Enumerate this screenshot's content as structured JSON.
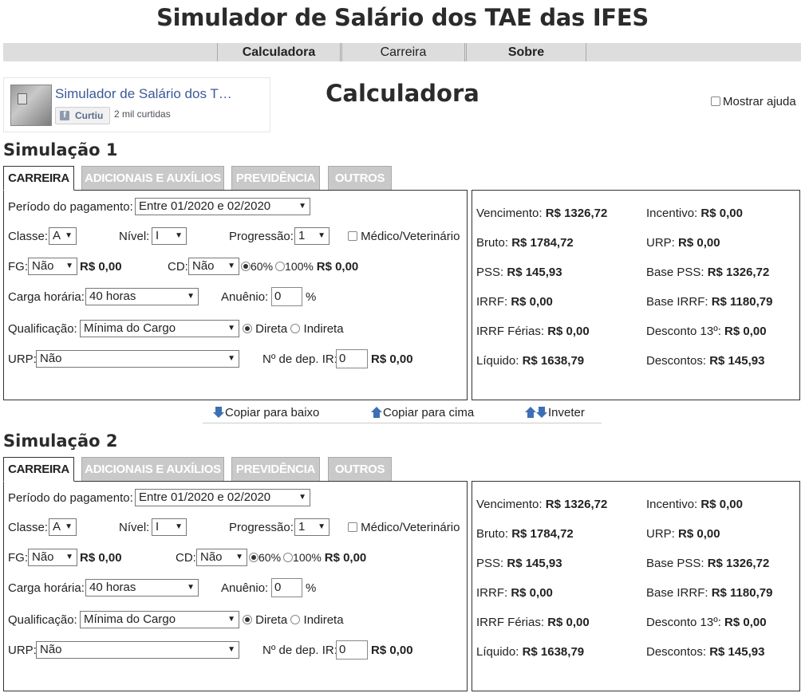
{
  "site_title": "Simulador de Salário dos TAE das IFES",
  "nav": [
    "Calculadora",
    "Carreira",
    "Sobre"
  ],
  "fb": {
    "page_name": "Simulador de Salário dos T…",
    "like_label": "Curtiu",
    "likes": "2 mil curtidas"
  },
  "page_title": "Calculadora",
  "help_label": "Mostrar ajuda",
  "copy": {
    "down": "Copiar para baixo",
    "up": "Copiar para cima",
    "swap": "Inveter"
  },
  "simulations": [
    {
      "title": "Simulação 1",
      "tabs": [
        "CARREIRA",
        "ADICIONAIS E AUXÍLIOS",
        "PREVIDÊNCIA",
        "OUTROS"
      ],
      "form": {
        "periodo_label": "Período do pagamento:",
        "periodo": "Entre 01/2020 e 02/2020",
        "classe_label": "Classe:",
        "classe": "A",
        "nivel_label": "Nível:",
        "nivel": "I",
        "progressao_label": "Progressão:",
        "progressao": "1",
        "medico_label": "Médico/Veterinário",
        "fg_label": "FG:",
        "fg": "Não",
        "fg_value": "R$ 0,00",
        "cd_label": "CD:",
        "cd": "Não",
        "cd_60": "60%",
        "cd_100": "100%",
        "cd_value": "R$ 0,00",
        "carga_label": "Carga horária:",
        "carga": "40 horas",
        "anuenio_label": "Anuênio:",
        "anuenio": "0",
        "anuenio_unit": "%",
        "qualificacao_label": "Qualificação:",
        "qualificacao": "Mínima do Cargo",
        "direta": "Direta",
        "indireta": "Indireta",
        "urp_label": "URP:",
        "urp": "Não",
        "dep_label": "Nº de dep. IR:",
        "dep": "0",
        "dep_value": "R$ 0,00"
      },
      "results": {
        "vencimento_label": "Vencimento:",
        "vencimento": "R$ 1326,72",
        "incentivo_label": "Incentivo:",
        "incentivo": "R$ 0,00",
        "bruto_label": "Bruto:",
        "bruto": "R$ 1784,72",
        "urp_label": "URP:",
        "urp": "R$ 0,00",
        "pss_label": "PSS:",
        "pss": "R$ 145,93",
        "base_pss_label": "Base PSS:",
        "base_pss": "R$ 1326,72",
        "irrf_label": "IRRF:",
        "irrf": "R$ 0,00",
        "base_irrf_label": "Base IRRF:",
        "base_irrf": "R$ 1180,79",
        "irrf_ferias_label": "IRRF Férias:",
        "irrf_ferias": "R$ 0,00",
        "desconto13_label": "Desconto 13º:",
        "desconto13": "R$ 0,00",
        "liquido_label": "Líquido:",
        "liquido": "R$ 1638,79",
        "descontos_label": "Descontos:",
        "descontos": "R$ 145,93"
      }
    },
    {
      "title": "Simulação 2",
      "tabs": [
        "CARREIRA",
        "ADICIONAIS E AUXÍLIOS",
        "PREVIDÊNCIA",
        "OUTROS"
      ],
      "form": {
        "periodo_label": "Período do pagamento:",
        "periodo": "Entre 01/2020 e 02/2020",
        "classe_label": "Classe:",
        "classe": "A",
        "nivel_label": "Nível:",
        "nivel": "I",
        "progressao_label": "Progressão:",
        "progressao": "1",
        "medico_label": "Médico/Veterinário",
        "fg_label": "FG:",
        "fg": "Não",
        "fg_value": "R$ 0,00",
        "cd_label": "CD:",
        "cd": "Não",
        "cd_60": "60%",
        "cd_100": "100%",
        "cd_value": "R$ 0,00",
        "carga_label": "Carga horária:",
        "carga": "40 horas",
        "anuenio_label": "Anuênio:",
        "anuenio": "0",
        "anuenio_unit": "%",
        "qualificacao_label": "Qualificação:",
        "qualificacao": "Mínima do Cargo",
        "direta": "Direta",
        "indireta": "Indireta",
        "urp_label": "URP:",
        "urp": "Não",
        "dep_label": "Nº de dep. IR:",
        "dep": "0",
        "dep_value": "R$ 0,00"
      },
      "results": {
        "vencimento_label": "Vencimento:",
        "vencimento": "R$ 1326,72",
        "incentivo_label": "Incentivo:",
        "incentivo": "R$ 0,00",
        "bruto_label": "Bruto:",
        "bruto": "R$ 1784,72",
        "urp_label": "URP:",
        "urp": "R$ 0,00",
        "pss_label": "PSS:",
        "pss": "R$ 145,93",
        "base_pss_label": "Base PSS:",
        "base_pss": "R$ 1326,72",
        "irrf_label": "IRRF:",
        "irrf": "R$ 0,00",
        "base_irrf_label": "Base IRRF:",
        "base_irrf": "R$ 1180,79",
        "irrf_ferias_label": "IRRF Férias:",
        "irrf_ferias": "R$ 0,00",
        "desconto13_label": "Desconto 13º:",
        "desconto13": "R$ 0,00",
        "liquido_label": "Líquido:",
        "liquido": "R$ 1638,79",
        "descontos_label": "Descontos:",
        "descontos": "R$ 145,93"
      }
    }
  ]
}
